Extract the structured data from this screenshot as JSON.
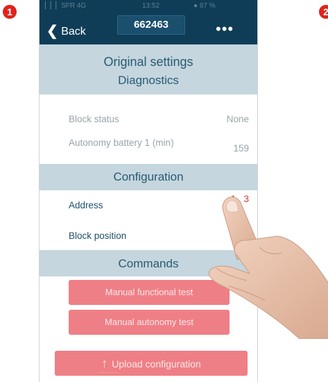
{
  "steps": {
    "first": "1",
    "second": "2"
  },
  "status_bar": {
    "carrier": "▏▏▏SFR  4G",
    "time": "13:52",
    "battery": "● 87 %"
  },
  "nav": {
    "back_label": "Back",
    "title": "662463",
    "more": "•••"
  },
  "screen": {
    "heading": "Original settings",
    "diagnostics": {
      "title": "Diagnostics",
      "rows": [
        {
          "label": "Block status",
          "value": "None"
        },
        {
          "label": "Autonomy battery 1 (min)",
          "value": "159"
        }
      ]
    },
    "configuration": {
      "title": "Configuration",
      "address_label": "Address",
      "address_value": "1   3",
      "block_position_label": "Block position"
    },
    "commands": {
      "title": "Commands",
      "functional_test": "Manual functional test",
      "autonomy_test": "Manual autonomy test",
      "upload": "Upload configuration"
    }
  },
  "colors": {
    "navbar": "#0f3d57",
    "section": "#c5d6de",
    "button": "#ef7f86",
    "badge": "#e0231a"
  }
}
